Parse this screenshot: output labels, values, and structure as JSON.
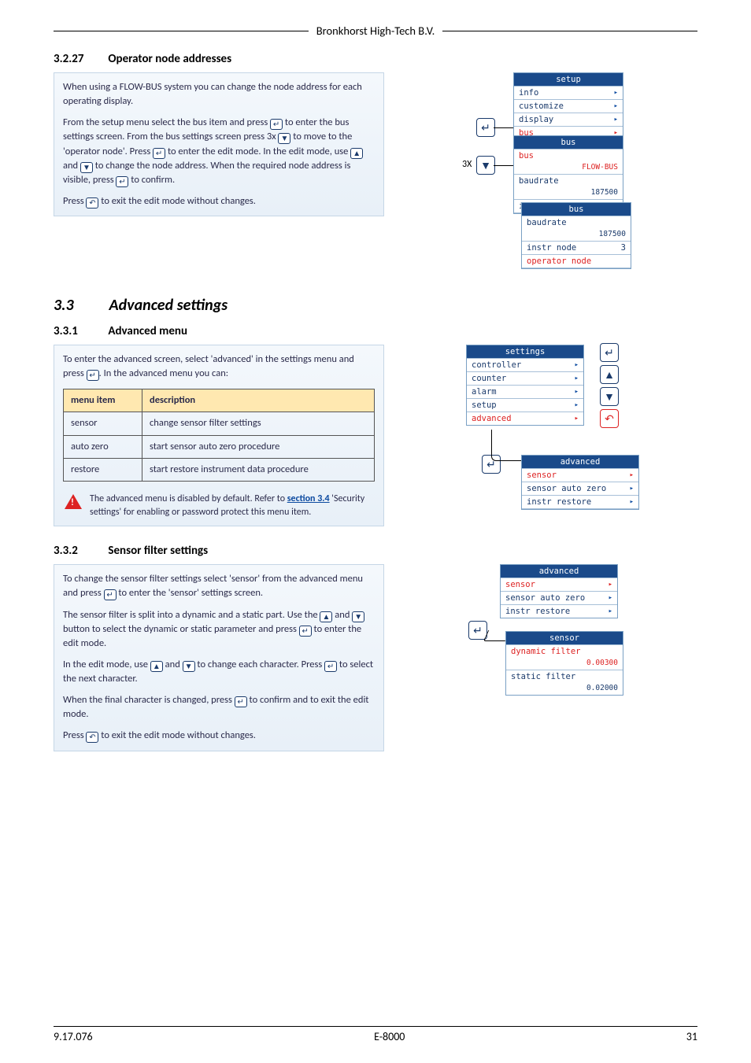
{
  "header": {
    "company": "Bronkhorst High-Tech B.V."
  },
  "sec3227": {
    "num": "3.2.27",
    "title": "Operator node addresses",
    "p1a": "When using a FLOW-BUS system you can change the node address for each operating display.",
    "p2a": "From the setup menu select the bus item and press ",
    "p2b": " to enter the bus settings screen. From the bus settings screen press 3x ",
    "p2c": " to move to the 'operator node'. Press ",
    "p2d": " to enter the edit mode. In the edit mode, use ",
    "p2e": " and ",
    "p2f": " to change the node address. When the required node address is visible, press ",
    "p2g": " to confirm.",
    "p3a": "Press ",
    "p3b": " to exit the edit mode without changes."
  },
  "sec33": {
    "num": "3.3",
    "title": "Advanced settings"
  },
  "sec331": {
    "num": "3.3.1",
    "title": "Advanced menu",
    "p1a": "To enter the advanced screen, select 'advanced' in the settings menu and press ",
    "p1b": ". In the advanced menu you can:",
    "th1": "menu item",
    "th2": "description",
    "r1c1": "sensor",
    "r1c2": "change sensor filter settings",
    "r2c1": "auto zero",
    "r2c2": "start sensor auto zero procedure",
    "r3c1": "restore",
    "r3c2": "start restore instrument data procedure",
    "warn1": "The advanced menu is disabled by default. Refer to ",
    "warnlink": "section 3.4",
    "warn2": " 'Security settings' for enabling or password protect this menu item."
  },
  "sec332": {
    "num": "3.3.2",
    "title": "Sensor filter settings",
    "p1a": "To change the sensor filter settings select 'sensor' from the advanced menu and press ",
    "p1b": " to enter the 'sensor' settings screen.",
    "p2a": "The sensor filter is split into a dynamic and a static part. Use the ",
    "p2b": " and ",
    "p2c": " button to select the dynamic or static parameter and press ",
    "p2d": " to enter the edit mode.",
    "p3a": "In the edit mode, use ",
    "p3b": " and ",
    "p3c": " to change each character. Press ",
    "p3d": " to select the next character.",
    "p4a": "When the final character is changed, press ",
    "p4b": " to confirm and to exit the edit mode.",
    "p5a": "Press ",
    "p5b": " to exit the edit mode without changes."
  },
  "figSetup": {
    "m1title": "setup",
    "m1r1": "info",
    "m1r2": "customize",
    "m1r3": "display",
    "m1r4": "bus",
    "m2title": "bus",
    "m2r1": "bus",
    "m2r1v": "FLOW-BUS",
    "m2r2": "baudrate",
    "m2r2v": "187500",
    "m2r3": "instr node",
    "m2r3v": "3",
    "m3title": "bus",
    "m3r1": "baudrate",
    "m3r1v": "187500",
    "m3r2": "instr node",
    "m3r2v": "3",
    "m3r3": "operator node",
    "lbl3x": "3X"
  },
  "figSettings": {
    "m1title": "settings",
    "m1r1": "controller",
    "m1r2": "counter",
    "m1r3": "alarm",
    "m1r4": "setup",
    "m1r5": "advanced",
    "m2title": "advanced",
    "m2r1": "sensor",
    "m2r2": "sensor auto zero",
    "m2r3": "instr restore"
  },
  "figSensor": {
    "m1title": "advanced",
    "m1r1": "sensor",
    "m1r2": "sensor auto zero",
    "m1r3": "instr restore",
    "m2title": "sensor",
    "m2r1": "dynamic filter",
    "m2r1v": "0.00300",
    "m2r2": "static filter",
    "m2r2v": "0.02000"
  },
  "footer": {
    "left": "9.17.076",
    "center": "E-8000",
    "right": "31"
  }
}
